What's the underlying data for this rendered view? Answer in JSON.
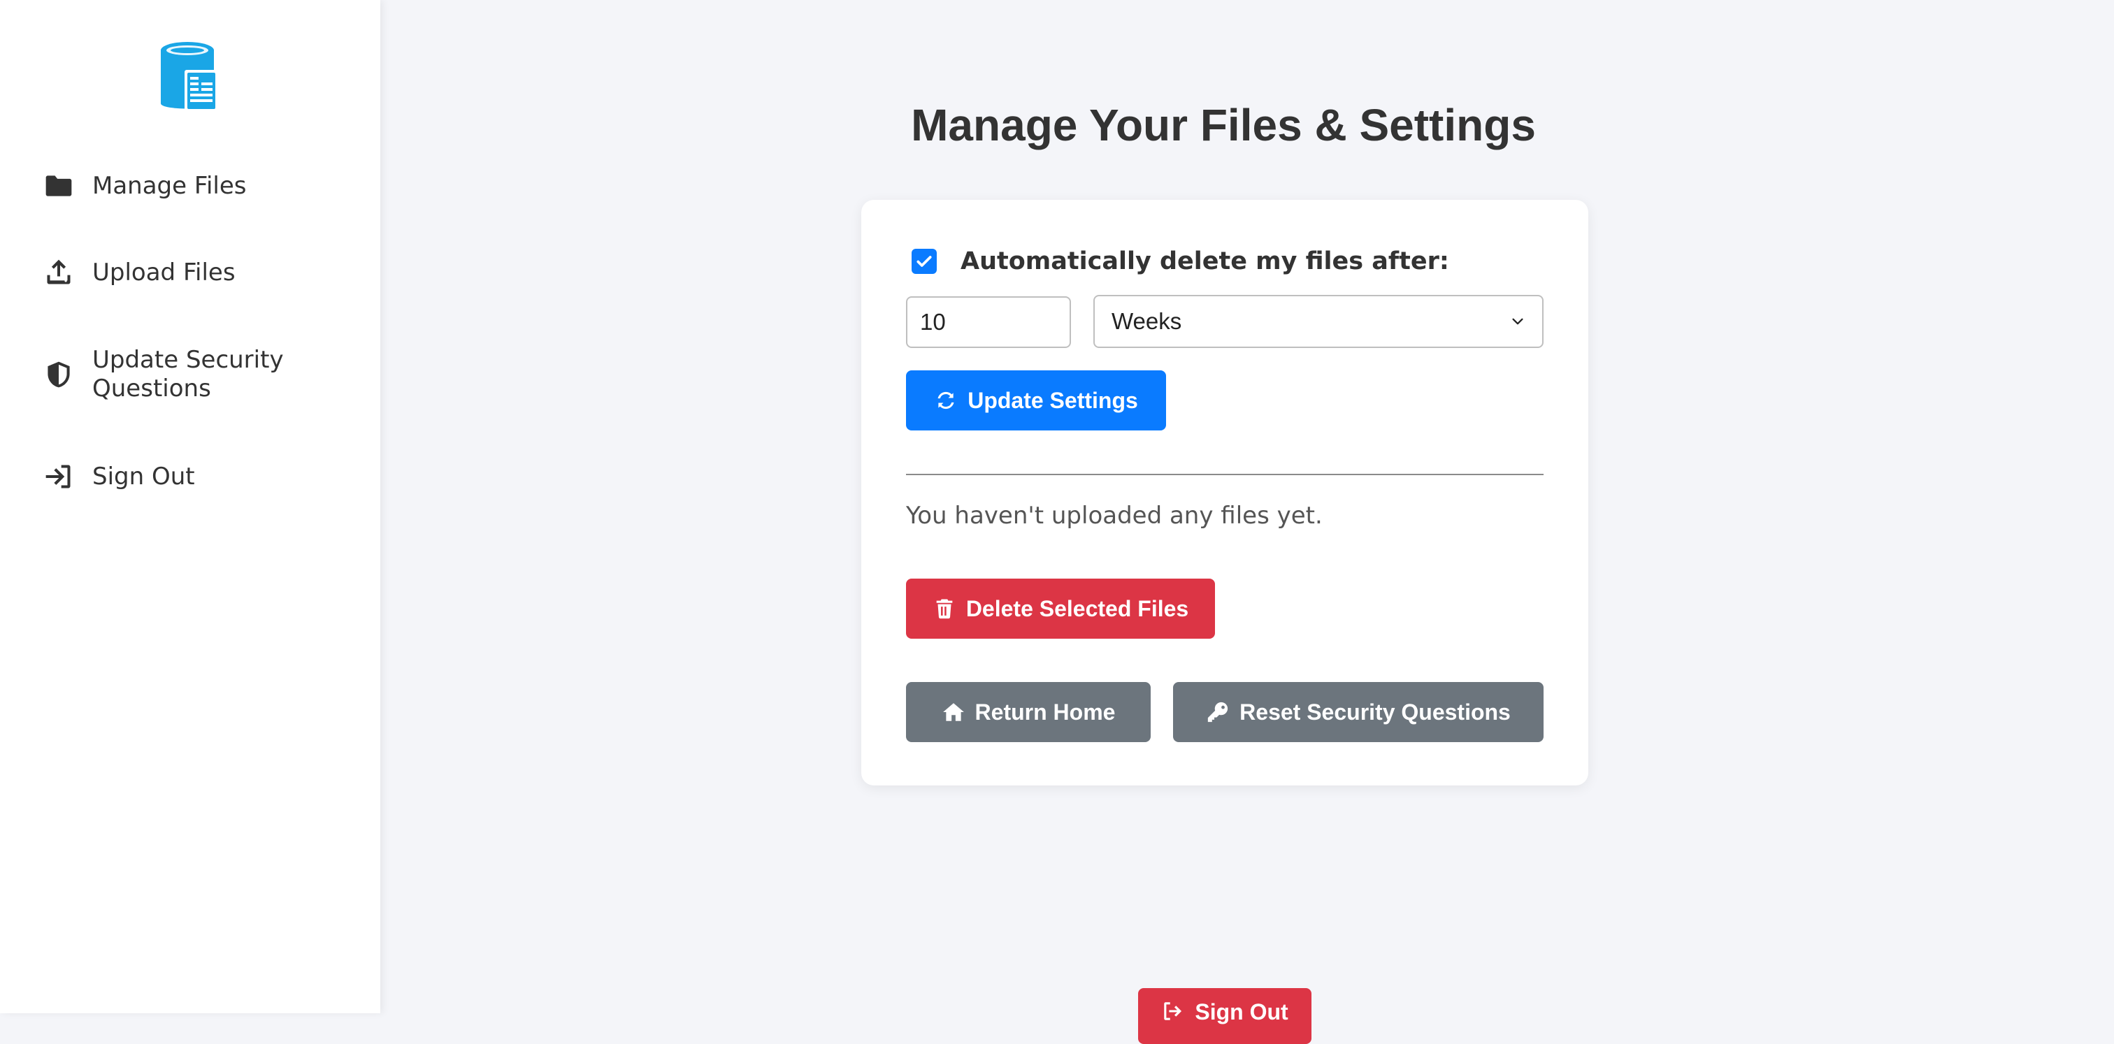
{
  "sidebar": {
    "logo_icon": "database-document-icon",
    "items": [
      {
        "label": "Manage Files",
        "icon": "folder-icon"
      },
      {
        "label": "Upload Files",
        "icon": "upload-icon"
      },
      {
        "label": "Update Security Questions",
        "icon": "shield-icon"
      },
      {
        "label": "Sign Out",
        "icon": "sign-in-arrow-icon"
      }
    ]
  },
  "main": {
    "title": "Manage Your Files & Settings",
    "settings": {
      "auto_delete_checked": true,
      "auto_delete_label": "Automatically delete my files after:",
      "duration_value": "10",
      "duration_unit": "Weeks",
      "update_button": "Update Settings"
    },
    "files": {
      "empty_message": "You haven't uploaded any files yet.",
      "delete_button": "Delete Selected Files"
    },
    "actions": {
      "return_home": "Return Home",
      "reset_security": "Reset Security Questions"
    },
    "footer_signout": "Sign Out"
  },
  "colors": {
    "primary": "#0a7bff",
    "danger": "#dc3545",
    "secondary": "#6c757d",
    "logo": "#1aa6e6",
    "background": "#f4f5f9"
  }
}
